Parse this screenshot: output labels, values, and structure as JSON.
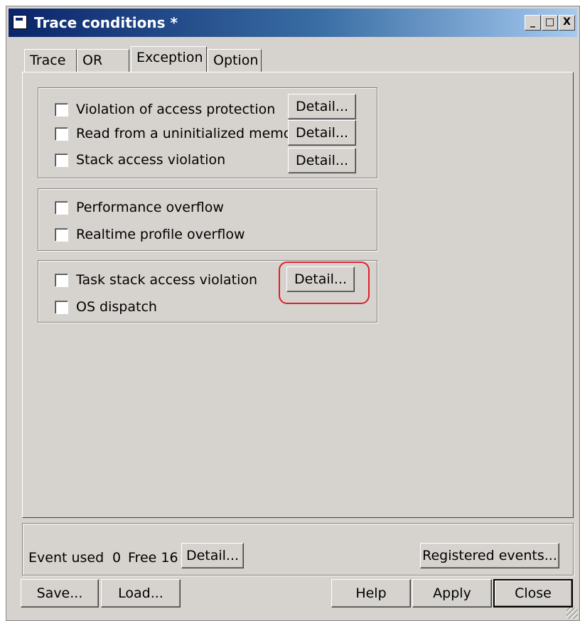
{
  "window": {
    "title": "Trace conditions *",
    "minimize_glyph": "_",
    "maximize_glyph": "□",
    "close_glyph": "X"
  },
  "tabs": [
    {
      "label": "Trace",
      "active": false
    },
    {
      "label": "OR",
      "active": false
    },
    {
      "label": "Exception",
      "active": true
    },
    {
      "label": "Option",
      "active": false
    }
  ],
  "exception": {
    "group1": [
      {
        "label": "Violation of access protection",
        "checked": false,
        "button": "Detail..."
      },
      {
        "label": "Read from a uninitialized memory",
        "checked": false,
        "button": "Detail..."
      },
      {
        "label": "Stack access violation",
        "checked": false,
        "button": "Detail..."
      }
    ],
    "group2": [
      {
        "label": "Performance overflow",
        "checked": false
      },
      {
        "label": "Realtime profile overflow",
        "checked": false
      }
    ],
    "group3": [
      {
        "label": "Task stack access violation",
        "checked": false,
        "button": "Detail..."
      },
      {
        "label": "OS dispatch",
        "checked": false
      }
    ]
  },
  "events": {
    "label": "Event used",
    "used": "0",
    "free_label": "Free 16",
    "detail_button": "Detail...",
    "registered_button": "Registered events..."
  },
  "footer": {
    "save": "Save...",
    "load": "Load...",
    "help": "Help",
    "apply": "Apply",
    "close": "Close"
  },
  "colors": {
    "dialog": "#d6d3ce",
    "title_start": "#0a246a",
    "title_end": "#a6caf0",
    "highlight": "#e01e2a"
  }
}
